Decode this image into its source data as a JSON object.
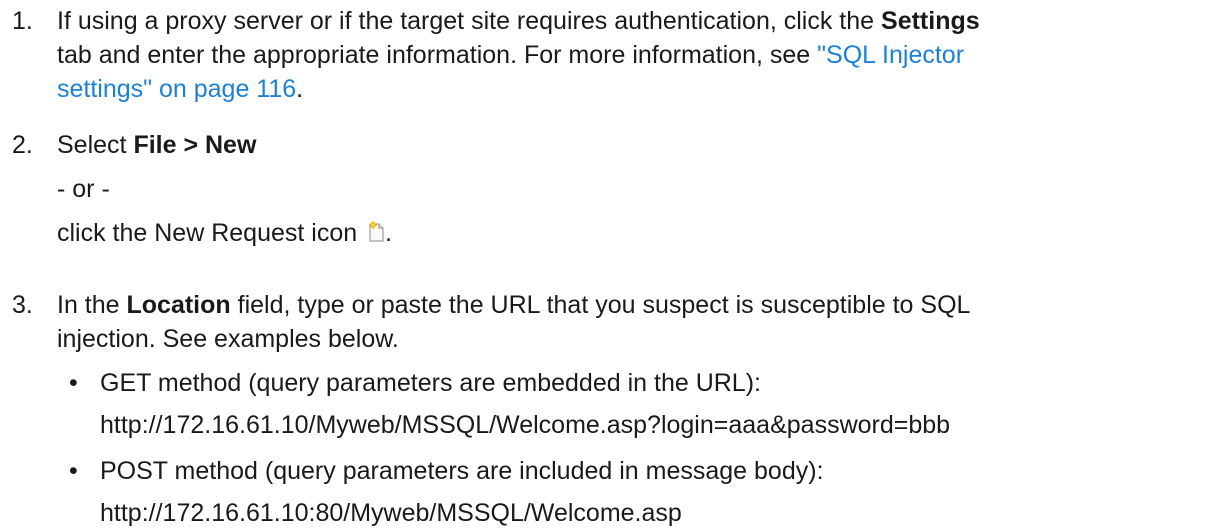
{
  "steps": [
    {
      "number": "1.",
      "text_1": "If using a proxy server or if the target site requires authentication, click the ",
      "bold_1": "Settings",
      "text_2": "tab and enter the appropriate information. For more information, see ",
      "link_1": "\"SQL Injector",
      "link_2": "settings\" on page 116",
      "text_3": "."
    },
    {
      "number": "2.",
      "text_1": "Select ",
      "bold_1": "File > New",
      "or_line": "- or -",
      "text_2": "click the New Request icon ",
      "text_3": ".",
      "icon": "new-request-icon"
    },
    {
      "number": "3.",
      "text_1": "In the ",
      "bold_1": "Location",
      "text_2": " field, type or paste the URL that you suspect is susceptible to SQL",
      "text_3": "injection. See examples below."
    }
  ],
  "bullets": [
    {
      "marker": "•",
      "label": "GET method (query parameters are embedded in the URL):",
      "url": "http://172.16.61.10/Myweb/MSSQL/Welcome.asp?login=aaa&password=bbb"
    },
    {
      "marker": "•",
      "label": "POST method (query parameters are included in message body):",
      "url": "http://172.16.61.10:80/Myweb/MSSQL/Welcome.asp"
    }
  ],
  "colors": {
    "text": "#1a1a1a",
    "link": "#1e7fd8"
  }
}
